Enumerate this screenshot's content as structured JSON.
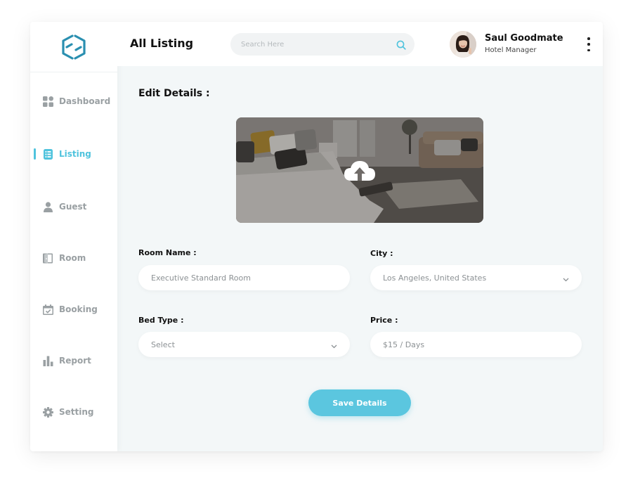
{
  "header": {
    "title": "All Listing",
    "search_placeholder": "Search Here",
    "user_name": "Saul Goodmate",
    "user_role": "Hotel Manager"
  },
  "sidebar": {
    "items": [
      {
        "label": "Dashboard",
        "icon": "grid-icon"
      },
      {
        "label": "Listing",
        "icon": "list-icon",
        "active": true
      },
      {
        "label": "Guest",
        "icon": "person-icon"
      },
      {
        "label": "Room",
        "icon": "door-icon"
      },
      {
        "label": "Booking",
        "icon": "calendar-icon"
      },
      {
        "label": "Report",
        "icon": "bar-chart-icon"
      },
      {
        "label": "Setting",
        "icon": "gear-icon"
      }
    ]
  },
  "form": {
    "title": "Edit Details :",
    "room_name_label": "Room Name :",
    "room_name_value": "Executive Standard Room",
    "city_label": "City :",
    "city_value": "Los Angeles, United States",
    "bed_type_label": "Bed Type :",
    "bed_type_value": "Select",
    "price_label": "Price :",
    "price_value": "$15 / Days",
    "save_label": "Save Details"
  },
  "colors": {
    "accent": "#4fc3dd",
    "button": "#5bc6df",
    "background": "#f3f7f8",
    "logo": "#2a8fb0"
  }
}
